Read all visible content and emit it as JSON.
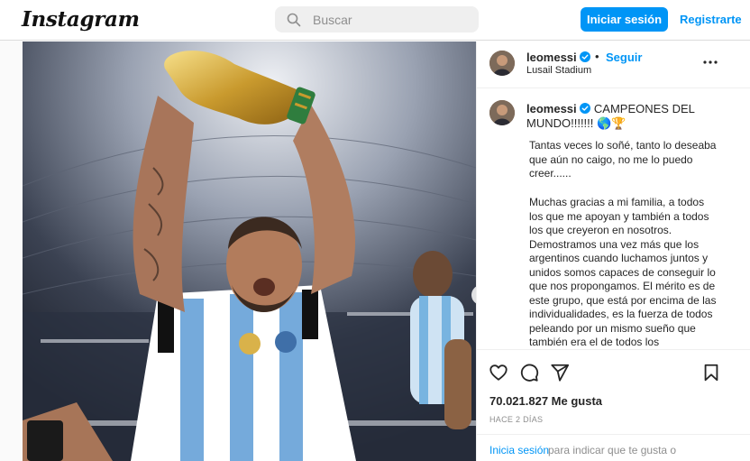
{
  "header": {
    "logo": "Instagram",
    "search_placeholder": "Buscar",
    "login_label": "Iniciar sesión",
    "register_label": "Registrarte"
  },
  "post": {
    "username": "leomessi",
    "separator": "•",
    "follow_label": "Seguir",
    "location": "Lusail Stadium",
    "caption_title": "CAMPEONES DEL MUNDO!!!!!!! 🌎🏆",
    "caption_paragraphs": [
      [
        "Tantas veces lo soñé, tanto lo deseaba",
        "que aún no caigo, no me lo puedo",
        "creer......"
      ],
      [
        "Muchas gracias a mi familia, a todos",
        "los que me apoyan y también a todos",
        "los que creyeron en nosotros.",
        "Demostramos una vez más que los",
        "argentinos cuando luchamos juntos y",
        "unidos somos capaces de conseguir lo",
        "que nos propongamos. El mérito es de",
        "este grupo, que está por encima de las",
        "individualidades, es la fuerza de todos",
        "peleando por un mismo sueño que",
        "también era el de todos los"
      ]
    ],
    "likes": "70.021.827 Me gusta",
    "time_ago": "HACE 2 DÍAS",
    "login_prompt_link": "Inicia sesión",
    "login_prompt_text": "para indicar que te gusta o"
  },
  "icons": {
    "search": "search-icon",
    "verified": "verified-badge-icon",
    "more": "more-options-icon",
    "like": "heart-icon",
    "comment": "comment-icon",
    "share": "share-icon",
    "save": "bookmark-icon",
    "next": "chevron-right-icon"
  },
  "colors": {
    "accent": "#0095f6",
    "text": "#262626",
    "muted": "#8e8e8e",
    "border": "#dbdbdb"
  }
}
